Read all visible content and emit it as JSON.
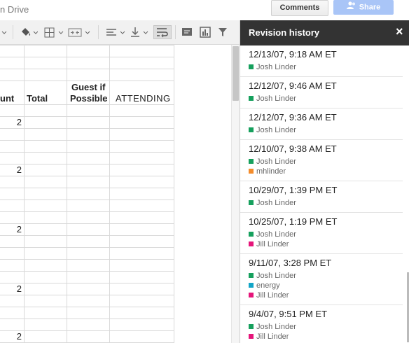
{
  "topbar": {
    "drive_label": "n Drive",
    "comments_label": "Comments",
    "share_label": "Share"
  },
  "toolbar": {
    "icons": [
      "paint-bucket-icon",
      "borders-icon",
      "merge-cells-icon",
      "align-horizontal-icon",
      "align-vertical-icon",
      "wrap-text-icon",
      "insert-comment-icon",
      "insert-chart-icon",
      "filter-icon"
    ]
  },
  "sheet": {
    "headers": {
      "count": "unt",
      "total": "Total",
      "guest_line1": "Guest if",
      "guest_line2": "Possible",
      "attending": "ATTENDING"
    },
    "values": [
      "2",
      "2",
      "2",
      "2",
      "2"
    ]
  },
  "revision_panel": {
    "title": "Revision history",
    "close_label": "×",
    "revisions": [
      {
        "date": "12/13/07, 9:18 AM ET",
        "authors": [
          {
            "name": "Josh Linder",
            "color": "#16a05d"
          }
        ]
      },
      {
        "date": "12/12/07, 9:46 AM ET",
        "authors": [
          {
            "name": "Josh Linder",
            "color": "#16a05d"
          }
        ]
      },
      {
        "date": "12/12/07, 9:36 AM ET",
        "authors": [
          {
            "name": "Josh Linder",
            "color": "#16a05d"
          }
        ]
      },
      {
        "date": "12/10/07, 9:38 AM ET",
        "authors": [
          {
            "name": "Josh Linder",
            "color": "#16a05d"
          },
          {
            "name": "mhlinder",
            "color": "#f48c2b"
          }
        ]
      },
      {
        "date": "10/29/07, 1:39 PM ET",
        "authors": [
          {
            "name": "Josh Linder",
            "color": "#16a05d"
          }
        ]
      },
      {
        "date": "10/25/07, 1:19 PM ET",
        "authors": [
          {
            "name": "Josh Linder",
            "color": "#16a05d"
          },
          {
            "name": "Jill Linder",
            "color": "#e5157a"
          }
        ]
      },
      {
        "date": "9/11/07, 3:28 PM ET",
        "authors": [
          {
            "name": "Josh Linder",
            "color": "#16a05d"
          },
          {
            "name": "energy",
            "color": "#12a5c7"
          },
          {
            "name": "Jill Linder",
            "color": "#e5157a"
          }
        ]
      },
      {
        "date": "9/4/07, 9:51 PM ET",
        "authors": [
          {
            "name": "Josh Linder",
            "color": "#16a05d"
          },
          {
            "name": "Jill Linder",
            "color": "#e5157a"
          }
        ]
      }
    ]
  }
}
